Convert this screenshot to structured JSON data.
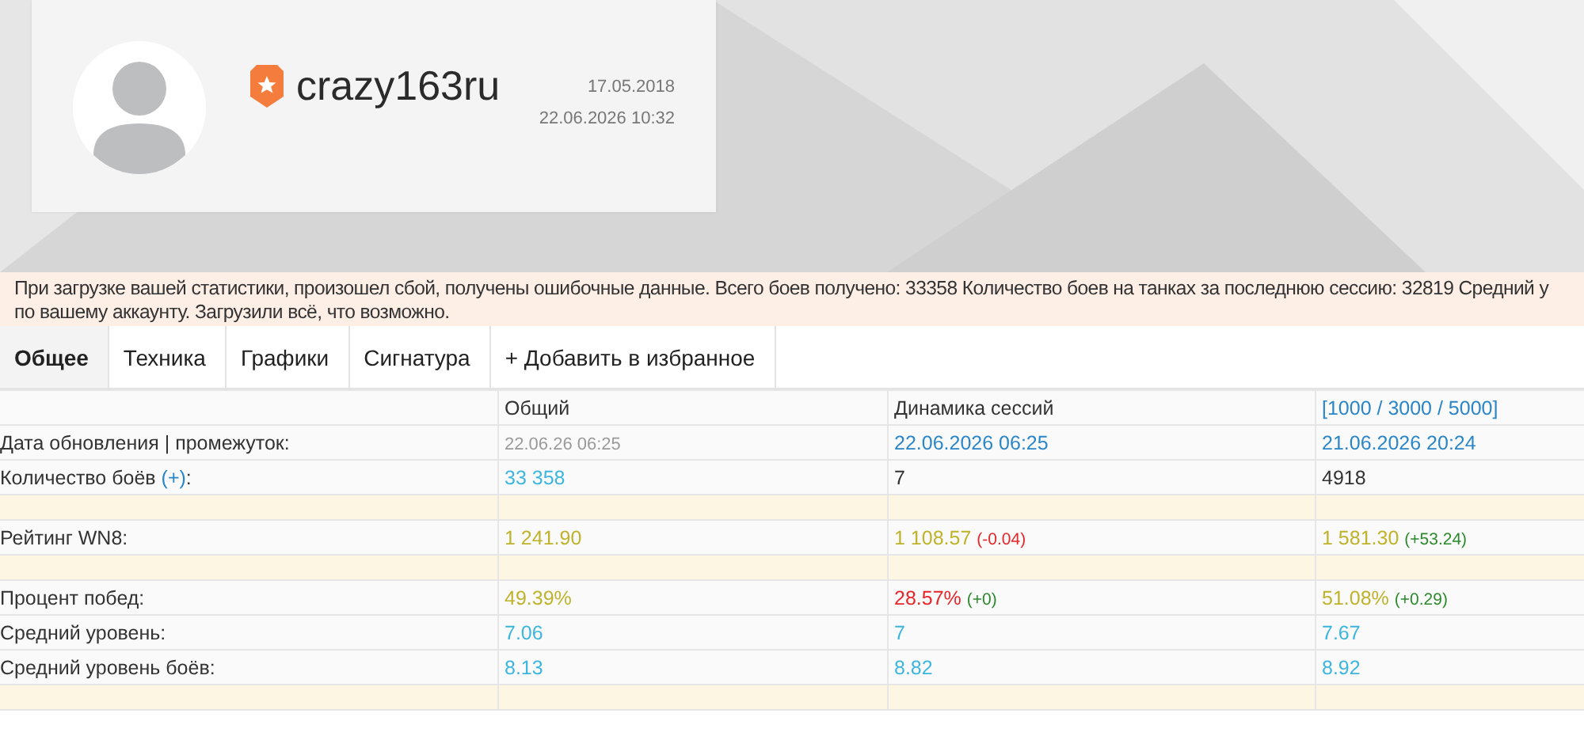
{
  "profile": {
    "name": "crazy163ru",
    "registered": "17.05.2018",
    "updated": "22.06.2026 10:32"
  },
  "alert": {
    "lines": [
      "При загрузке вашей статистики, произошел сбой, получены ошибочные данные. Всего боев получено: 33358 Количество боев на танках за последнюю сессию: 32819 Средний у",
      "по вашему аккаунту. Загрузили всё, что возможно."
    ]
  },
  "tabs": [
    {
      "label": "Общее",
      "selected": true
    },
    {
      "label": "Техника",
      "selected": false
    },
    {
      "label": "Графики",
      "selected": false
    },
    {
      "label": "Сигнатура",
      "selected": false
    },
    {
      "label": "+ Добавить в избранное",
      "selected": false
    }
  ],
  "table": {
    "columns": [
      {
        "label": "Общий",
        "kind": "plain"
      },
      {
        "label": "Динамика сессий",
        "kind": "plain"
      },
      {
        "label": "[1000 / 3000 / 5000]",
        "kind": "link"
      }
    ],
    "rows": [
      {
        "kind": "data",
        "label": "Дата обновления | промежуток:",
        "cells": [
          {
            "value": "22.06.26 06:25",
            "color": "#9a9a9a"
          },
          {
            "value": "22.06.2026 06:25",
            "color": "#2a86c8"
          },
          {
            "value": "21.06.2026 20:24",
            "color": "#2a86c8"
          }
        ]
      },
      {
        "kind": "data",
        "label": "Количество боёв ",
        "label_link": "(+)",
        "label_end": ":",
        "cells": [
          {
            "value": "33 358",
            "color": "#3cb6de"
          },
          {
            "value": "7",
            "color": "#333333"
          },
          {
            "value": "4918",
            "color": "#333333"
          }
        ]
      },
      {
        "kind": "spacer"
      },
      {
        "kind": "data",
        "label": "Рейтинг WN8:",
        "cells": [
          {
            "value": "1 241.90",
            "color": "#bfb32c"
          },
          {
            "value": "1 108.57",
            "color": "#bfb32c",
            "delta": {
              "value": "(-0.04)",
              "color": "#e8262a"
            }
          },
          {
            "value": "1 581.30",
            "color": "#bfb32c",
            "delta": {
              "value": "(+53.24)",
              "color": "#2c8a2c"
            }
          }
        ]
      },
      {
        "kind": "spacer"
      },
      {
        "kind": "data",
        "label": "Процент побед:",
        "cells": [
          {
            "value": "49.39%",
            "color": "#bfb32c"
          },
          {
            "value": "28.57%",
            "color": "#e8262a",
            "delta": {
              "value": "(+0)",
              "color": "#2c8a2c"
            }
          },
          {
            "value": "51.08%",
            "color": "#bfb32c",
            "delta": {
              "value": "(+0.29)",
              "color": "#2c8a2c"
            }
          }
        ]
      },
      {
        "kind": "data",
        "label": "Средний уровень:",
        "cells": [
          {
            "value": "7.06",
            "color": "#3cb6de"
          },
          {
            "value": "7",
            "color": "#3cb6de"
          },
          {
            "value": "7.67",
            "color": "#3cb6de"
          }
        ]
      },
      {
        "kind": "data",
        "label": "Средний уровень боёв:",
        "cells": [
          {
            "value": "8.13",
            "color": "#3cb6de"
          },
          {
            "value": "8.82",
            "color": "#3cb6de"
          },
          {
            "value": "8.92",
            "color": "#3cb6de"
          }
        ]
      },
      {
        "kind": "spacer"
      }
    ]
  }
}
